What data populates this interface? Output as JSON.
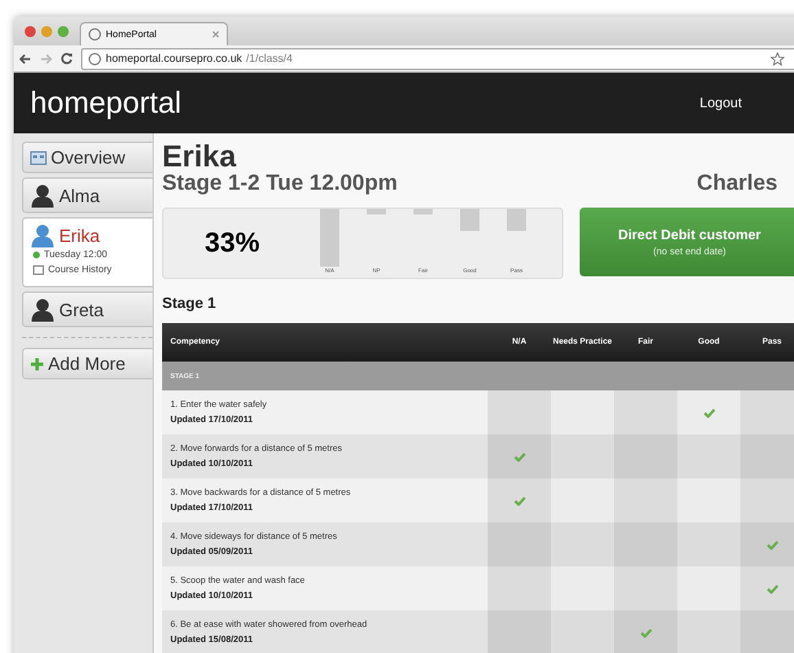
{
  "browser": {
    "tab_title": "HomePortal",
    "url_host": "homeportal.coursepro.co.uk",
    "url_path": "/1/class/4"
  },
  "header": {
    "logo": "homeportal",
    "logout": "Logout"
  },
  "sidebar": {
    "items": [
      {
        "label": "Overview",
        "kind": "overview",
        "selected": false
      },
      {
        "label": "Alma",
        "kind": "person",
        "selected": false
      },
      {
        "label": "Erika",
        "kind": "person",
        "selected": true,
        "children": [
          {
            "label": "Tuesday 12:00",
            "kind": "status"
          },
          {
            "label": "Course History",
            "kind": "history"
          }
        ]
      },
      {
        "label": "Greta",
        "kind": "person",
        "selected": false
      }
    ],
    "add_more": "Add More"
  },
  "student": {
    "name": "Erika",
    "class": "Stage 1-2 Tue 12.00pm",
    "teacher": "Charles"
  },
  "progress": {
    "percent": "33%",
    "bar_labels": [
      "N/A",
      "NP",
      "Fair",
      "Good",
      "Pass"
    ]
  },
  "billing": {
    "title": "Direct Debit customer",
    "note": "(no set end date)"
  },
  "stage_title": "Stage 1",
  "table": {
    "columns": [
      "Competency",
      "N/A",
      "Needs Practice",
      "Fair",
      "Good",
      "Pass"
    ],
    "group": "STAGE 1",
    "rows": [
      {
        "competency": "1. Enter the water safely",
        "updated": "Updated 17/10/2011",
        "checks": [
          false,
          false,
          false,
          true,
          false
        ]
      },
      {
        "competency": "2. Move forwards for a distance of 5 metres",
        "updated": "Updated 10/10/2011",
        "checks": [
          true,
          false,
          false,
          false,
          false
        ]
      },
      {
        "competency": "3. Move backwards for a distance of 5 metres",
        "updated": "Updated 17/10/2011",
        "checks": [
          true,
          false,
          false,
          false,
          false
        ]
      },
      {
        "competency": "4. Move sideways for distance of 5 metres",
        "updated": "Updated 05/09/2011",
        "checks": [
          false,
          false,
          false,
          false,
          true
        ]
      },
      {
        "competency": "5. Scoop the water and wash face",
        "updated": "Updated 10/10/2011",
        "checks": [
          false,
          false,
          false,
          false,
          true
        ]
      },
      {
        "competency": "6. Be at ease with water showered from overhead",
        "updated": "Updated 15/08/2011",
        "checks": [
          false,
          false,
          true,
          false,
          false
        ]
      }
    ]
  }
}
